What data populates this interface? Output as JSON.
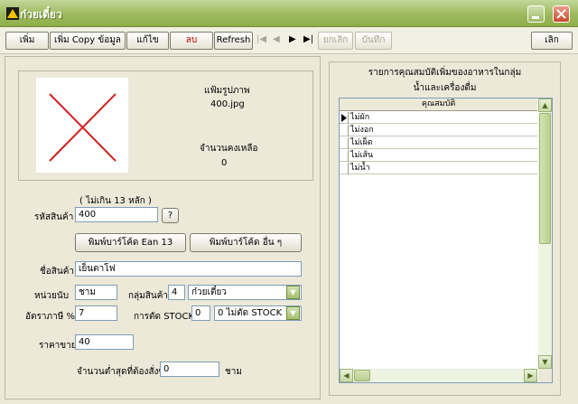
{
  "window": {
    "title": "ก๋วยเตี๋ยว"
  },
  "toolbar": {
    "add": "เพิ่ม",
    "add_copy": "เพิ่ม Copy ข้อมูล",
    "edit": "แก้ไข",
    "delete": "ลบ",
    "refresh": "Refresh",
    "nav_first": "|◀",
    "nav_prev": "◀",
    "nav_next": "▶",
    "nav_last": "▶|",
    "cancel": "ยกเลิก",
    "save": "บันทึก",
    "exit": "เลิก"
  },
  "image_panel": {
    "file_label": "แฟ้มรูปภาพ",
    "file_name": "400.jpg",
    "remaining_label": "จำนวนคงเหลือ",
    "remaining_value": "0"
  },
  "form": {
    "code_hint": "( ไม่เกิน 13 หลัก )",
    "code_label": "รหัสสินค้า",
    "code_value": "400",
    "code_help": "?",
    "print_ean13": "พิมพ์บาร์โค้ด Ean 13",
    "print_other": "พิมพ์บาร์โค้ด อื่น ๆ",
    "name_label": "ชื่อสินค้า",
    "name_value": "เย็นตาโฟ",
    "unit_label": "หน่วยนับ",
    "unit_value": "ชาม",
    "group_label": "กลุ่มสินค้า",
    "group_code": "4",
    "group_name": "ก๋วยเตี๋ยว",
    "vat_label": "อัตราภาษี %",
    "vat_value": "7",
    "stock_label": "การตัด STOCK",
    "stock_code": "0",
    "stock_name": "0 ไม่ตัด STOCK",
    "price_label": "ราคาขาย",
    "price_value": "40",
    "min_order_label": "จำนวนต่ำสุดที่ต้องสั่งซื้อ",
    "min_order_value": "0",
    "min_order_unit": "ชาม"
  },
  "options_panel": {
    "title_line1": "รายการคุณสมบัติเพิ่มของอาหารในกลุ่ม",
    "title_line2": "น้ำและเครื่องดื่ม",
    "column_header": "คุณสมบัติ",
    "rows": [
      "ไม่ผัก",
      "ไม่งอก",
      "ไม่เผ็ด",
      "ไม่เส้น",
      "ไม่น้ำ"
    ]
  },
  "colors": {
    "accent": "#8EAE4C",
    "title_text": "#FFFFFF",
    "delete_text": "#C00000",
    "error_x": "#D02020"
  }
}
